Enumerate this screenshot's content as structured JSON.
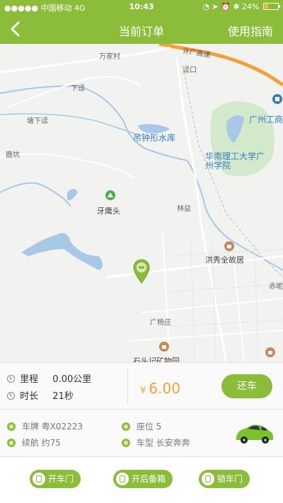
{
  "status_bar": {
    "signal": "●●●●● 中国移动  4G",
    "time": "10:43",
    "indicators": "◔ ➤ ⏰ ✱ 24%"
  },
  "nav": {
    "back_icon": "chevron-left-icon",
    "title": "当前订单",
    "guide": "使用指南"
  },
  "map": {
    "labels": {
      "expressway": "许广高速",
      "wanjiacun": "万家村",
      "xiatu": "下迳",
      "nanxiajing": "塘下迳",
      "xiakou": "迳口",
      "luhang": "鹿坑",
      "lake": "吊钟形水库",
      "ya_ying_tou": "牙鹰头",
      "scut": "华南理工大学广州学院",
      "gz_industry": "广州工商",
      "lin_pai": "林益",
      "hongxiuquan": "洪秀全故居",
      "guangyang": "广杨庄",
      "kiln": "石头记矿物园",
      "chijing": "赤坭"
    },
    "colors": {
      "background": "#f2f2f0",
      "water": "#a8c8e8",
      "road": "#ffffff",
      "highway": "#f2a13a",
      "park": "#cfe8c8",
      "marker": "#8bbd3a"
    },
    "marker_icon": "car-location-pin-icon"
  },
  "trip": {
    "distance_label": "里程",
    "distance_value": "0.00公里",
    "duration_label": "时长",
    "duration_value": "21秒",
    "currency": "¥",
    "price": "6.00",
    "return_button": "还车"
  },
  "car": {
    "plate_label": "车牌",
    "plate_value": "粤X02223",
    "seats_label": "座位",
    "seats_value": "5",
    "range_label": "续航",
    "range_value": "约75",
    "model_label": "车型",
    "model_value": "长安奔奔",
    "image_icon": "green-car-image"
  },
  "actions": {
    "open_door": "开车门",
    "open_trunk": "开后备箱",
    "lock_door": "锁车门"
  },
  "theme": {
    "accent": "#8bbd3a",
    "price_color": "#f2a13a"
  }
}
